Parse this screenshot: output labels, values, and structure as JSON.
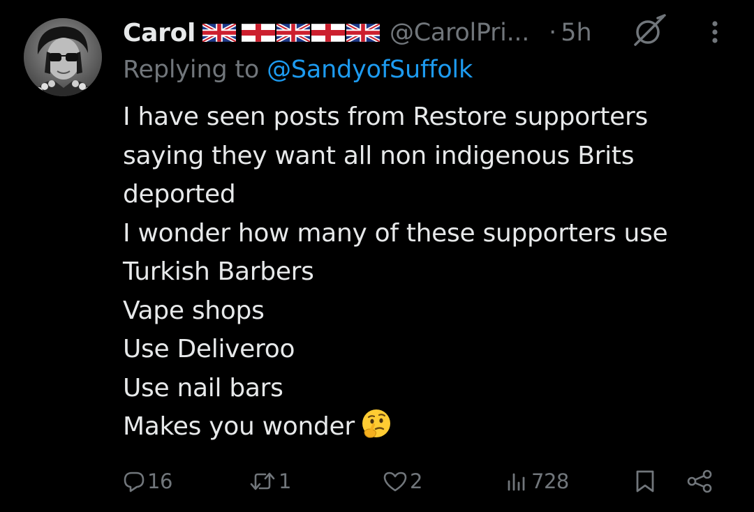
{
  "tweet": {
    "author": {
      "display_name": "Carol",
      "flags": [
        "uk-flag",
        "england-flag",
        "uk-flag",
        "england-flag",
        "uk-flag"
      ],
      "handle": "@CarolPri...",
      "separator": "·",
      "time": "5h"
    },
    "reply_context": {
      "prefix": "Replying to",
      "mention": "@SandyofSuffolk"
    },
    "text_lines": [
      "I have seen posts from Restore supporters",
      "saying they want all non indigenous Brits",
      "deported",
      "I wonder how many of these supporters use",
      "Turkish Barbers",
      "Vape shops",
      "Use Deliveroo",
      "Use nail bars",
      "Makes you wonder"
    ],
    "emoji": "thinking-face",
    "actions": {
      "replies": "16",
      "reposts": "1",
      "likes": "2",
      "views": "728"
    }
  },
  "colors": {
    "background": "#000000",
    "text": "#e7e9ea",
    "secondary": "#71767b",
    "link": "#1d9bf0"
  }
}
